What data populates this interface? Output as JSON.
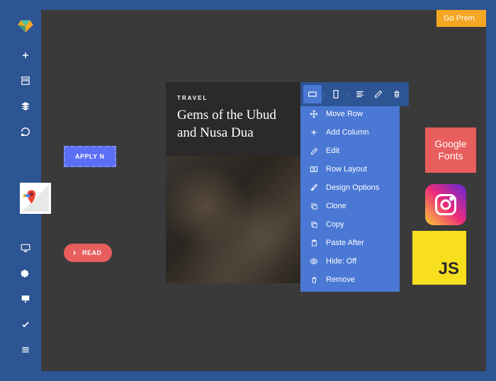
{
  "premium": "Go Prem",
  "buttons": {
    "apply": "APPLY N",
    "read": "READ"
  },
  "card": {
    "category": "TRAVEL",
    "title": "Gems of the Ubud and Nusa Dua"
  },
  "menu": {
    "items": [
      {
        "icon": "move",
        "label": "Move Row"
      },
      {
        "icon": "plus",
        "label": "Add Column"
      },
      {
        "icon": "pencil",
        "label": "Edit"
      },
      {
        "icon": "columns",
        "label": "Row Layout"
      },
      {
        "icon": "brush",
        "label": "Design Options"
      },
      {
        "icon": "clone",
        "label": "Clone"
      },
      {
        "icon": "copy",
        "label": "Copy"
      },
      {
        "icon": "paste",
        "label": "Paste After"
      },
      {
        "icon": "eye",
        "label": "Hide: Off"
      },
      {
        "icon": "trash",
        "label": "Remove"
      }
    ]
  },
  "logos": {
    "gfonts_line1": "Google",
    "gfonts_line2": "Fonts",
    "js": "JS"
  }
}
